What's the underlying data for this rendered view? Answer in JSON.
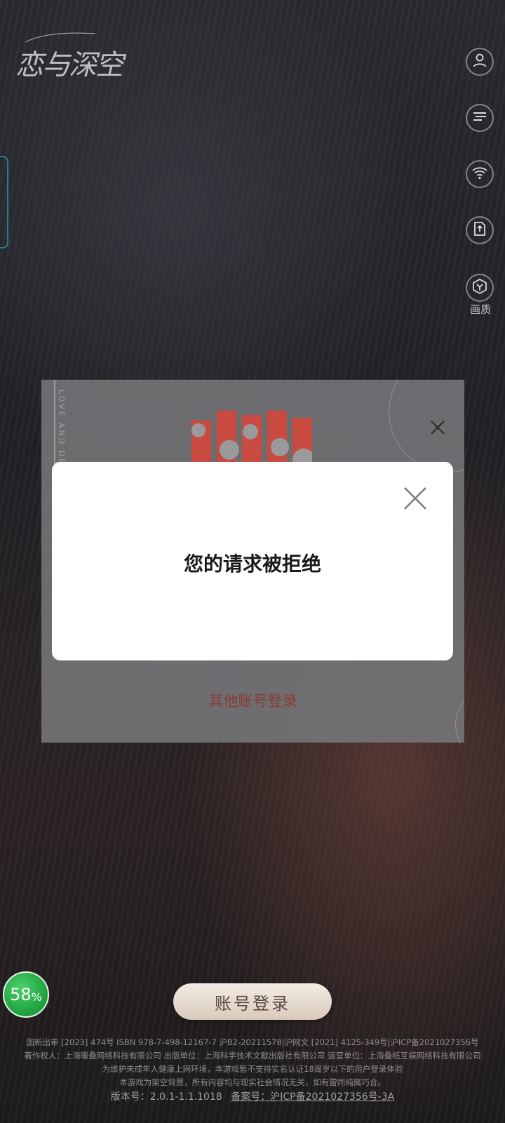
{
  "app": {
    "logo_text": "恋与深空"
  },
  "side_buttons": [
    {
      "name": "account",
      "icon": "user-icon"
    },
    {
      "name": "announcement",
      "icon": "notice-icon"
    },
    {
      "name": "network",
      "icon": "wifi-icon"
    },
    {
      "name": "export",
      "icon": "export-icon"
    },
    {
      "name": "quality",
      "icon": "quality-icon",
      "label": "画质"
    }
  ],
  "panel": {
    "vertical_text": "LOVE AND DE",
    "other_login": "其他账号登录"
  },
  "dialog": {
    "message": "您的请求被拒绝"
  },
  "progress": {
    "value": "58",
    "sign": "%"
  },
  "account_login": "账号登录",
  "footer": {
    "line1": "国新出审 [2023] 474号  ISBN 978-7-498-12167-7  沪B2-20211578|沪网文 [2021] 4125-349号|沪ICP备2021027356号",
    "line2": "著作权人：上海暖叠网络科技有限公司  出版单位：上海科学技术文献出版社有限公司  运营单位：上海叠纸互娱网络科技有限公司",
    "line3": "为维护未成年人健康上网环境，本游戏暂不支持实名认证18周岁以下的用户登录体验",
    "line4": "本游戏为架空背景，所有内容均与现实社会情况无关，如有雷同纯属巧合。",
    "version": "版本号：2.0.1-1.1.1018",
    "icp": "备案号：沪ICP备2021027356号-3A"
  },
  "colors": {
    "accent": "#8a3b33",
    "brand_red": "#d84a3c",
    "badge_green": "#1e9e3c"
  }
}
